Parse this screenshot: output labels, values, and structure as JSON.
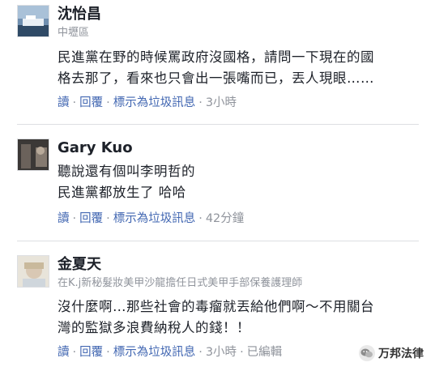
{
  "comments": [
    {
      "name": "沈怡昌",
      "location": "中壢區",
      "lines": [
        "民進黨在野的時候罵政府沒國格，請問一下現在的國",
        "格去那了，看來也只會出一張嘴而已，丟人現眼……"
      ],
      "actions": {
        "read": "讀",
        "reply": "回覆",
        "spam": "標示為垃圾訊息",
        "time": "3小時"
      }
    },
    {
      "name": "Gary Kuo",
      "lines": [
        "聽說還有個叫李明哲的",
        "民進黨都放生了 哈哈"
      ],
      "actions": {
        "read": "讀",
        "reply": "回覆",
        "spam": "標示為垃圾訊息",
        "time": "42分鐘"
      }
    },
    {
      "name": "金夏天",
      "bio": "在K.j新秘髮妝美甲沙龍擔任日式美甲手部保養護理師",
      "lines": [
        "沒什麼啊…那些社會的毒瘤就丟給他們啊～不用關台",
        "灣的監獄多浪費納稅人的錢！！"
      ],
      "actions": {
        "read": "讀",
        "reply": "回覆",
        "spam": "標示為垃圾訊息",
        "time": "3小時",
        "edited": "已編輯"
      }
    }
  ],
  "watermark": {
    "text": "万邦法律"
  }
}
